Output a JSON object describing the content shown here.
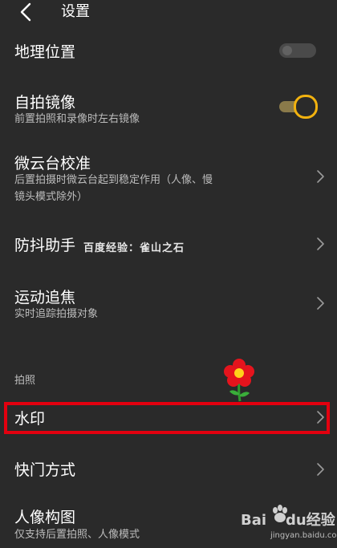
{
  "header": {
    "back_icon": "chevron-left-icon",
    "title": "设置"
  },
  "settings": {
    "location": {
      "title": "地理位置",
      "toggle": "off"
    },
    "selfie_mirror": {
      "title": "自拍镜像",
      "subtitle": "前置拍照和录像时左右镜像",
      "toggle": "on"
    },
    "gimbal": {
      "title": "微云台校准",
      "subtitle": "后置拍摄时微云台起到稳定作用（人像、慢镜头模式除外）"
    },
    "stabilizer": {
      "title": "防抖助手"
    },
    "tracking": {
      "title": "运动追焦",
      "subtitle": "实时追踪拍摄对象"
    },
    "section_photo": {
      "label": "拍照"
    },
    "watermark_setting": {
      "title": "水印"
    },
    "shutter": {
      "title": "快门方式"
    },
    "portrait": {
      "title": "人像构图",
      "subtitle": "仅支持后置拍照、人像模式"
    }
  },
  "overlay": {
    "watermark_text": "百度经验：雀山之石",
    "baidu_brand": "Bai",
    "baidu_brand_du": "du",
    "baidu_jingyan": "经验",
    "baidu_url": "jingyan.baidu.com"
  },
  "colors": {
    "background": "#2a2a2a",
    "accent": "#f2b20f",
    "highlight": "#e3000f"
  }
}
